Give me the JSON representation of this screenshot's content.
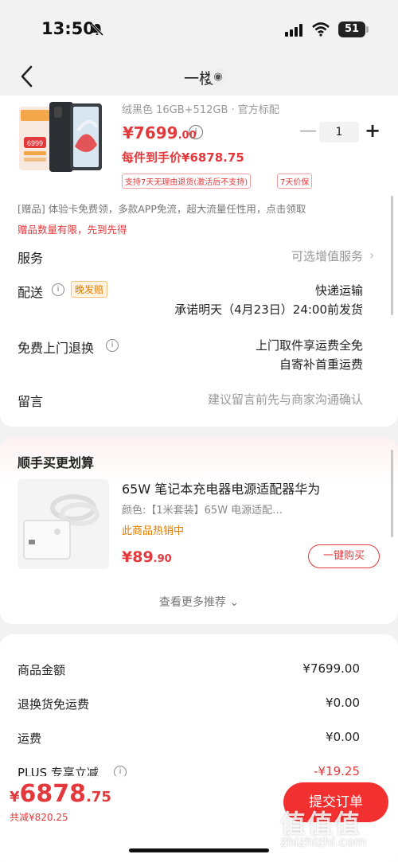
{
  "status_bar": {
    "time": "13:50",
    "battery": "51"
  },
  "header": {
    "title": "一楼"
  },
  "product": {
    "spec": "绒黑色 16GB+512GB · 官方标配",
    "price_int": "¥7699",
    "price_dec": ".00",
    "quantity": "1",
    "each_price": "每件到手价¥6878.75",
    "tags": [
      "支持7天无理由退货(激活后不支持)",
      "7天价保"
    ],
    "promo_badge": "6999"
  },
  "gift": {
    "line": "[赠品] 体验卡免费领，多款APP免流，超大流量任性用，点击领取",
    "limit": "赠品数量有限，先到先得"
  },
  "rows": {
    "service_label": "服务",
    "service_value": "可选增值服务",
    "delivery_label": "配送",
    "delivery_badge": "晚发赔",
    "delivery_line1": "快递运输",
    "delivery_line2": "承诺明天（4月23日）24:00前发货",
    "return_label": "免费上门退换",
    "return_line1": "上门取件享运费全免",
    "return_line2": "自寄补首重运费",
    "message_label": "留言",
    "message_placeholder": "建议留言前先与商家沟通确认"
  },
  "recommend": {
    "section_title": "顺手买更划算",
    "item_title": "65W 笔记本充电器电源适配器华为",
    "item_color": "颜色:【1米套装】65W 电源适配…",
    "item_hot": "此商品热销中",
    "item_price_int": "¥89",
    "item_price_dec": ".90",
    "buy_label": "一键购买",
    "more_label": "查看更多推荐"
  },
  "summary": {
    "items": [
      {
        "label": "商品金额",
        "value": "¥7699.00"
      },
      {
        "label": "退换货免运费",
        "value": "¥0.00"
      },
      {
        "label": "运费",
        "value": "¥0.00"
      },
      {
        "label": "PLUS 专享立减",
        "value": "-¥19.25"
      }
    ]
  },
  "bottom": {
    "total_yen": "¥",
    "total_int": "6878",
    "total_dec": ".75",
    "saved": "共减¥820.25",
    "submit": "提交订单"
  },
  "watermark": {
    "main": "值值值",
    "sub": "zhizhizhi.com"
  },
  "colors": {
    "accent": "#e4393c",
    "badge_orange": "#e07b00"
  }
}
